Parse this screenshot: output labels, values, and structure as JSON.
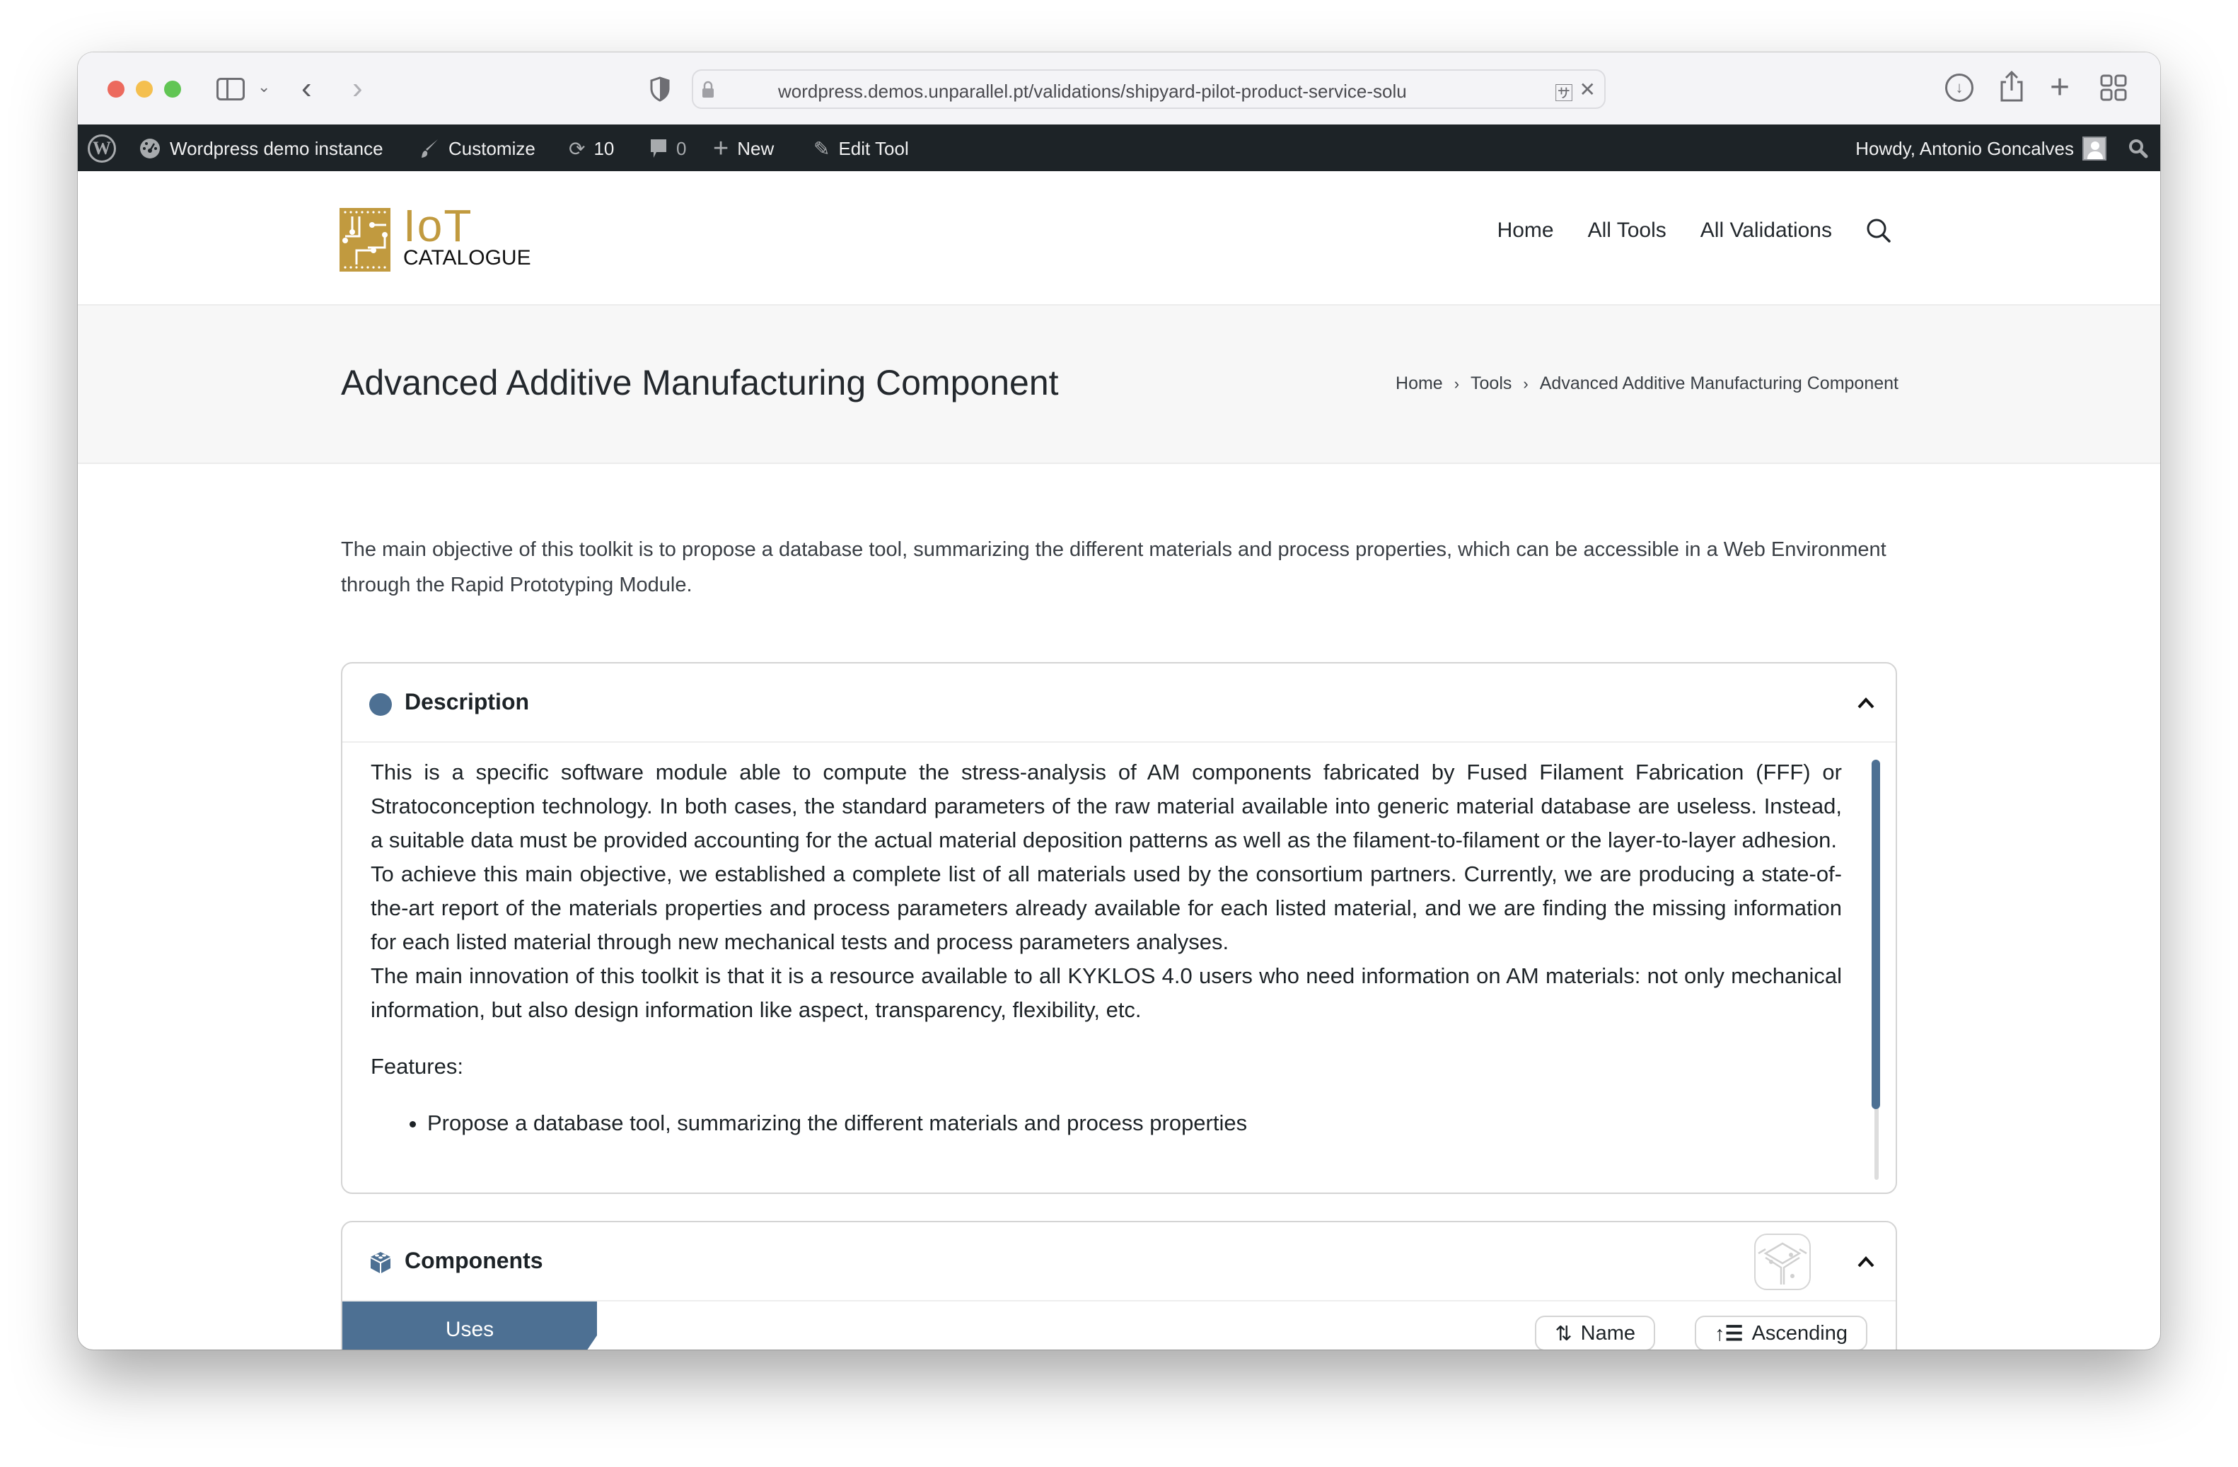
{
  "browser": {
    "url": "wordpress.demos.unparallel.pt/validations/shipyard-pilot-product-service-solu",
    "icons": [
      "sidebar-icon",
      "chevron-down-icon",
      "back-icon",
      "forward-icon",
      "shield-icon",
      "lock-icon",
      "translate-icon",
      "close-icon",
      "download-icon",
      "share-icon",
      "new-tab-icon",
      "tab-overview-icon"
    ]
  },
  "adminbar": {
    "site_name": "Wordpress demo instance",
    "customize": "Customize",
    "updates_count": "10",
    "comments_count": "0",
    "new": "New",
    "edit": "Edit Tool",
    "greeting": "Howdy, Antonio Goncalves"
  },
  "header": {
    "logo_top": "IoT",
    "logo_bottom": "CATALOGUE",
    "nav": [
      "Home",
      "All Tools",
      "All Validations"
    ]
  },
  "title_band": {
    "title": "Advanced Additive Manufacturing Component",
    "breadcrumb": [
      "Home",
      "Tools",
      "Advanced Additive Manufacturing Component"
    ]
  },
  "intro": "The main objective of this toolkit is to propose a database tool, summarizing the different materials and process properties, which can be accessible in a Web Environment through the Rapid Prototyping Module.",
  "description": {
    "title": "Description",
    "paragraphs": [
      "This is a specific software module able to compute the stress-analysis of AM components fabricated by Fused Filament Fabrication (FFF) or Stratoconception technology. In both cases, the standard parameters of the raw material available into generic material database are useless. Instead, a suitable data must be provided accounting for the actual material deposition patterns as well as the filament-to-filament or the layer-to-layer adhesion.",
      "To achieve this main objective, we established a complete list of all materials used by the consortium partners. Currently, we are producing a state-of-the-art report of the materials properties and process parameters already available for each listed material, and we are finding the missing information for each listed material through new mechanical tests and process parameters analyses.",
      "The main innovation of this toolkit is that it is a resource available to all KYKLOS 4.0 users who need information on AM materials: not only mechanical information, but also design information like aspect, transparency, flexibility, etc."
    ],
    "features_label": "Features:",
    "features": [
      "Propose a database tool, summarizing the different materials and process properties"
    ]
  },
  "components": {
    "title": "Components",
    "tab": "Uses",
    "sort_field": "Name",
    "sort_order": "Ascending"
  },
  "colors": {
    "accent": "#4d7093",
    "logo_gold": "#c19a3f",
    "adminbar_bg": "#1d2327"
  }
}
